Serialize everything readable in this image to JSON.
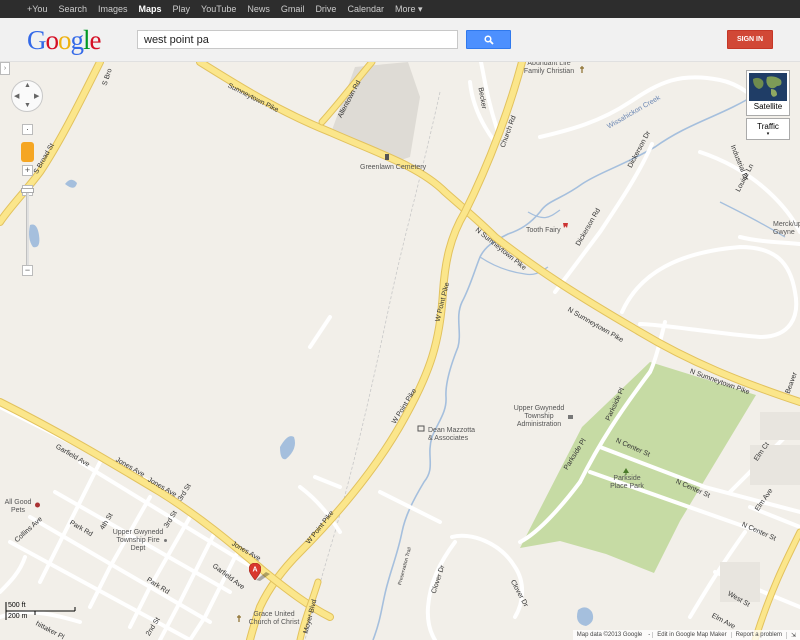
{
  "google_bar": {
    "links": [
      {
        "label": "+You",
        "active": false
      },
      {
        "label": "Search",
        "active": false
      },
      {
        "label": "Images",
        "active": false
      },
      {
        "label": "Maps",
        "active": true
      },
      {
        "label": "Play",
        "active": false
      },
      {
        "label": "YouTube",
        "active": false
      },
      {
        "label": "News",
        "active": false
      },
      {
        "label": "Gmail",
        "active": false
      },
      {
        "label": "Drive",
        "active": false
      },
      {
        "label": "Calendar",
        "active": false
      },
      {
        "label": "More ▾",
        "active": false
      }
    ]
  },
  "header": {
    "logo": "Google",
    "search_value": "west point pa",
    "search_icon": "search-icon",
    "signin_label": "SIGN IN"
  },
  "map_controls": {
    "collapse_icon": "›",
    "zoom_in": "+",
    "zoom_out": "−",
    "satellite_label": "Satellite",
    "traffic_label": "Traffic",
    "traffic_chevron": "▾"
  },
  "scale": {
    "feet": "500 ft",
    "meters": "200 m"
  },
  "footer": {
    "map_data": "Map data ©2013 Google",
    "sep": "-",
    "edit_link": "Edit in Google Map Maker",
    "report_link": "Report a problem"
  },
  "places": {
    "greenlawn": "Greenlawn Cemetery",
    "upper_life": "Abundant Life Family Christian",
    "tooth_fairy": "Tooth Fairy",
    "dean": "Dean Mazzotta & Associates",
    "township": "Upper Gwynedd Township Administration",
    "parkside": "Parkside Place Park",
    "fire_dept": "Upper Gwynedd Township Fire Dept",
    "all_good": "All Good Pets",
    "grace": "Grace United Church of Christ",
    "merck": "Merck/up Gwyne"
  },
  "roads": {
    "sumneytown_1": "Sumneytown Pike",
    "sumneytown_2": "N Sumneytown Pike",
    "sumneytown_3": "N Sumneytown Pike",
    "sumneytown_4": "N Sumneytown Pike",
    "w_point_1": "W Point Pike",
    "w_point_2": "W Point Pike",
    "w_point_3": "W Point Pike",
    "church": "Church Rd",
    "allentown": "Allentown Rd",
    "broad": "S Broad St",
    "s_bro": "S Bro",
    "dickerson_1": "Dickerson Dr",
    "dickerson_2": "Dickerson Rd",
    "wissahickon": "Wissahickon Creek",
    "industrial": "Industrial Dr",
    "louise": "Louise Ln",
    "beaver": "Beaver",
    "becker": "Becker",
    "garfield_1": "Garfield Ave",
    "garfield_2": "Garfield Ave",
    "jones_1": "Jones Ave",
    "jones_2": "Jones Ave",
    "jones_3": "Jones Ave",
    "park_1": "Park Rd",
    "park_2": "Park Rd",
    "fourth": "4th St",
    "third_1": "3rd St",
    "third_2": "3rd St",
    "second": "2nd St",
    "collins": "Collins Ave",
    "whittaker": "hittaker Pl",
    "moyer": "Moyer Blvd",
    "parkside_dr": "Parkside Pl",
    "parkside_pl": "Parkside Pl",
    "n_center_1": "N Center St",
    "n_center_2": "N Center St",
    "n_center_3": "N Center St",
    "elm_1": "Elm Ave",
    "elm_2": "Elm Ave",
    "elm_ct": "Elm Ct",
    "west_st": "West St",
    "clover_1": "Clover Dr",
    "clover_2": "Clover Dr",
    "preservation": "Preservation Trail",
    "merck_rd": "Merck/up"
  }
}
